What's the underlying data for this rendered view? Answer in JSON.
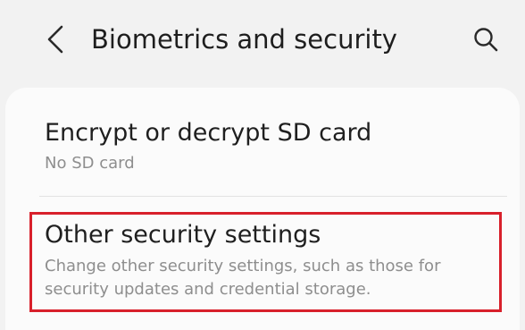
{
  "header": {
    "title": "Biometrics and security",
    "back_icon": "chevron-left-icon",
    "search_icon": "search-icon"
  },
  "settings": {
    "items": [
      {
        "title": "Encrypt or decrypt SD card",
        "subtitle": "No SD card"
      },
      {
        "title": "Other security settings",
        "subtitle_line1": "Change other security settings, such as those for",
        "subtitle_line2": "security updates and credential storage."
      }
    ]
  },
  "colors": {
    "background": "#f2f2f2",
    "card": "#fbfbfb",
    "highlight_border": "#d8202b",
    "title_text": "#1f1f1f",
    "subtitle_text": "#8e8e8e"
  }
}
